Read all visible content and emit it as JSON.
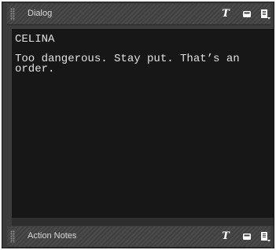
{
  "dialog_panel": {
    "title": "Dialog",
    "character": "CELINA",
    "text": "Too dangerous. Stay put. That’s an\norder."
  },
  "action_panel": {
    "title": "Action Notes"
  },
  "icons": {
    "text_format": "T",
    "toggle": "panel-toggle-icon",
    "menu": "page-menu-icon"
  },
  "colors": {
    "panel_bg": "#3c3c3c",
    "editor_bg": "#171717",
    "text": "#e2e2e2"
  }
}
